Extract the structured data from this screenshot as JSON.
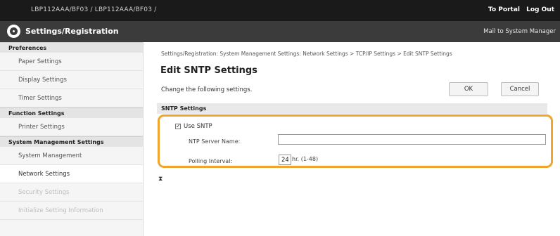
{
  "header": {
    "device_name": "LBP112AAA/BF03 / LBP112AAA/BF03 /",
    "to_portal": "To Portal",
    "log_out": "Log Out",
    "app_title": "Settings/Registration",
    "mail_link": "Mail to System Manager"
  },
  "sidebar": {
    "sections": [
      {
        "title": "Preferences",
        "items": [
          "Paper Settings",
          "Display Settings",
          "Timer Settings"
        ]
      },
      {
        "title": "Function Settings",
        "items": [
          "Printer Settings"
        ]
      },
      {
        "title": "System Management Settings",
        "items": [
          "System Management",
          "Network Settings",
          "Security Settings",
          "Initialize Setting Information"
        ]
      }
    ],
    "active_item": "Network Settings"
  },
  "main": {
    "breadcrumb": "Settings/Registration: System Management Settings: Network Settings > TCP/IP Settings > Edit SNTP Settings",
    "title": "Edit SNTP Settings",
    "description": "Change the following settings.",
    "ok_label": "OK",
    "cancel_label": "Cancel",
    "section_title": "SNTP Settings",
    "use_sntp_label": "Use SNTP",
    "use_sntp_checked": true,
    "checkbox_mark": "✓",
    "ntp_server_label": "NTP Server Name:",
    "ntp_server_value": "",
    "polling_label": "Polling Interval:",
    "polling_value": "24",
    "polling_unit": "hr. (1-48)",
    "hourglass_glyph": "⧗"
  },
  "colors": {
    "top_bar": "#1a1a1a",
    "title_bar": "#3b3b3b",
    "highlight": "#f0a52c"
  }
}
